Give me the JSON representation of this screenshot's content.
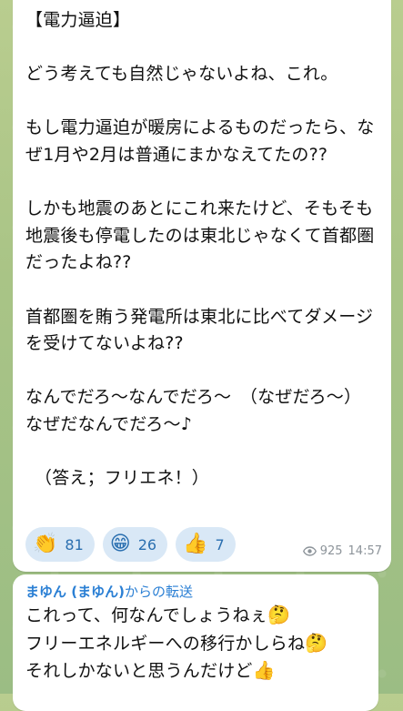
{
  "message1": {
    "paragraphs": [
      "【電力逼迫】",
      "どう考えても自然じゃないよね、これ。",
      "もし電力逼迫が暖房によるものだったら、なぜ1月や2月は普通にまかなえてたの??",
      "しかも地震のあとにこれ来たけど、そもそも地震後も停電したのは東北じゃなくて首都圏だったよね??",
      "首都圏を賄う発電所は東北に比べてダメージを受けてないよね??",
      "なんでだろ〜なんでだろ〜　（なぜだろ〜）　なぜだなんでだろ〜♪",
      "（答え；フリエネ！）"
    ],
    "reactions": [
      {
        "emoji": "👏",
        "emoji_name": "clapping-hands-icon",
        "count": "81"
      },
      {
        "emoji": "😁",
        "emoji_name": "grinning-face-icon",
        "count": "26"
      },
      {
        "emoji": "👍",
        "emoji_name": "thumbs-up-icon",
        "count": "7"
      }
    ],
    "views": "925",
    "time": "14:57"
  },
  "message2": {
    "forward_name": "まゆん (まゆん)",
    "forward_suffix": "からの転送",
    "lines": [
      {
        "text": "これって、何なんでしょうねぇ",
        "emoji": "🤔",
        "emoji_name": "thinking-face-icon"
      },
      {
        "text": "フリーエネルギーへの移行かしらね",
        "emoji": "🤔",
        "emoji_name": "thinking-face-icon"
      },
      {
        "text": "それしかないと思うんだけど",
        "emoji": "👍",
        "emoji_name": "thumbs-up-icon"
      }
    ]
  },
  "colors": {
    "link_blue": "#2a7fd4",
    "reaction_bg": "#d9e8f6",
    "meta_gray": "#8d949a"
  }
}
